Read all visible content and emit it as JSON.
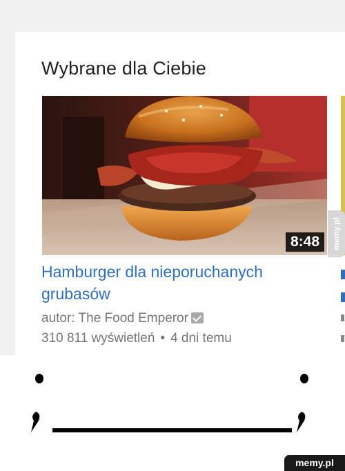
{
  "section": {
    "title": "Wybrane dla Ciebie"
  },
  "video": {
    "title": "Hamburger dla nieporuchanych grubasów",
    "author": "autor: The Food Emperor",
    "views": "310 811 wyświetleń",
    "separator": "•",
    "age": "4 dni temu",
    "duration": "8:48",
    "thumbnail_subject": "burger-with-bacon-and-sauce"
  },
  "watermark": {
    "side": "memy.pl",
    "bottom": "memy.pl"
  },
  "colors": {
    "link_blue": "#2d6ec7",
    "meta_gray": "#767676",
    "page_bg": "#f1f1f1",
    "card_bg": "#ffffff"
  }
}
